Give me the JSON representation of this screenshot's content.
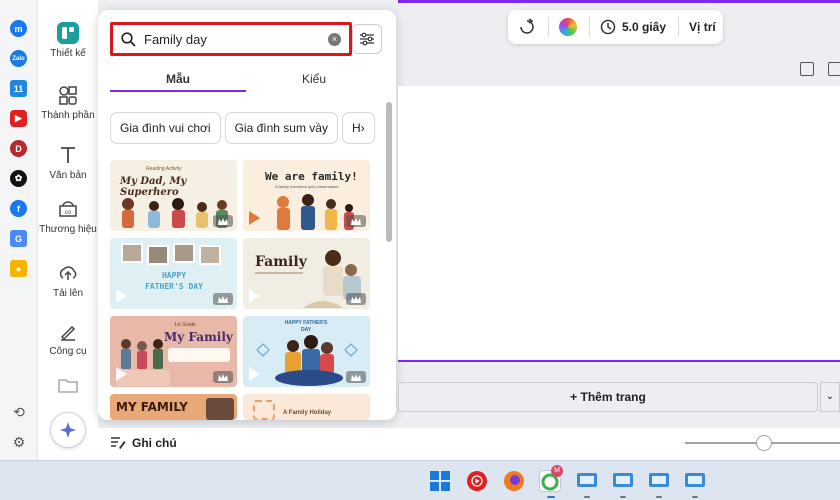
{
  "search": {
    "value": "Family day",
    "placeholder": ""
  },
  "tabs": [
    {
      "label": "Mẫu"
    },
    {
      "label": "Kiểu"
    }
  ],
  "chips": [
    "Gia đình vui chơi",
    "Gia đình sum vầy",
    "H›"
  ],
  "sidenav": [
    {
      "label": "Thiết kế",
      "icon": "layout-icon"
    },
    {
      "label": "Thành phần",
      "icon": "shapes-icon"
    },
    {
      "label": "Văn bản",
      "icon": "text-icon"
    },
    {
      "label": "Thương hiệu",
      "icon": "brand-icon"
    },
    {
      "label": "Tải lên",
      "icon": "upload-icon"
    },
    {
      "label": "Công cụ",
      "icon": "tools-icon"
    }
  ],
  "templates": [
    {
      "title": "My Dad, My Superhero",
      "subtitle": "Reading Activity"
    },
    {
      "title": "We are family!",
      "subtitle": "A family members quiz presentation"
    },
    {
      "title": "HAPPY FATHER'S DAY",
      "subtitle": ""
    },
    {
      "title": "Family",
      "subtitle": ""
    },
    {
      "title": "My Family",
      "subtitle": "1st Grade"
    },
    {
      "title": "HAPPY FATHER'S DAY",
      "subtitle": ""
    },
    {
      "title": "MY FAMILY",
      "subtitle": ""
    },
    {
      "title": "A Family Holiday",
      "subtitle": ""
    }
  ],
  "toolbar": {
    "duration": "5.0 giây",
    "position": "Vị trí"
  },
  "add_page_label": "+ Thêm trang",
  "notes_label": "Ghi chú",
  "colors": {
    "accent": "#7d2ae8",
    "highlight": "#d8161e",
    "teal": "#1a9e9e"
  }
}
